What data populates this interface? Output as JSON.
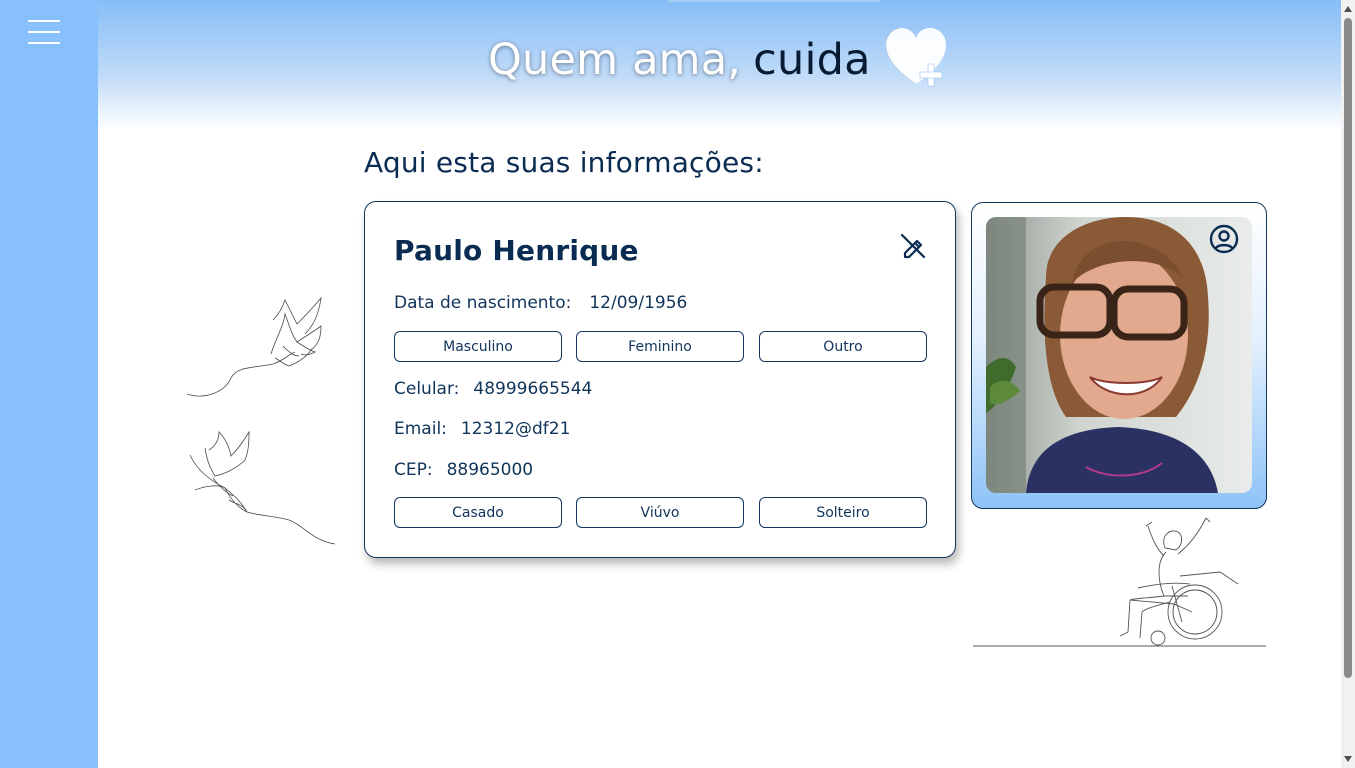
{
  "header": {
    "brand_part1": "Quem ama,",
    "brand_part2": "cuida",
    "brand_icon": "heart-plus-icon"
  },
  "sidebar": {
    "menu_icon": "hamburger-menu-icon"
  },
  "page": {
    "heading": "Aqui esta suas informações:"
  },
  "profile": {
    "name": "Paulo Henrique",
    "birth_label": "Data de nascimento:",
    "birth_value": "12/09/1956",
    "gender_options": [
      "Masculino",
      "Feminino",
      "Outro"
    ],
    "phone_label": "Celular:",
    "phone_value": "48999665544",
    "email_label": "Email:",
    "email_value": "12312@df21",
    "cep_label": "CEP:",
    "cep_value": "88965000",
    "marital_options": [
      "Casado",
      "Viúvo",
      "Solteiro"
    ]
  },
  "icons": {
    "edit": "pencil-off-icon",
    "profile": "user-circle-icon"
  },
  "colors": {
    "sidebar": "#87c0fb",
    "header_top": "#86bdf7",
    "text_primary": "#0b2c52",
    "border": "#12365c"
  }
}
